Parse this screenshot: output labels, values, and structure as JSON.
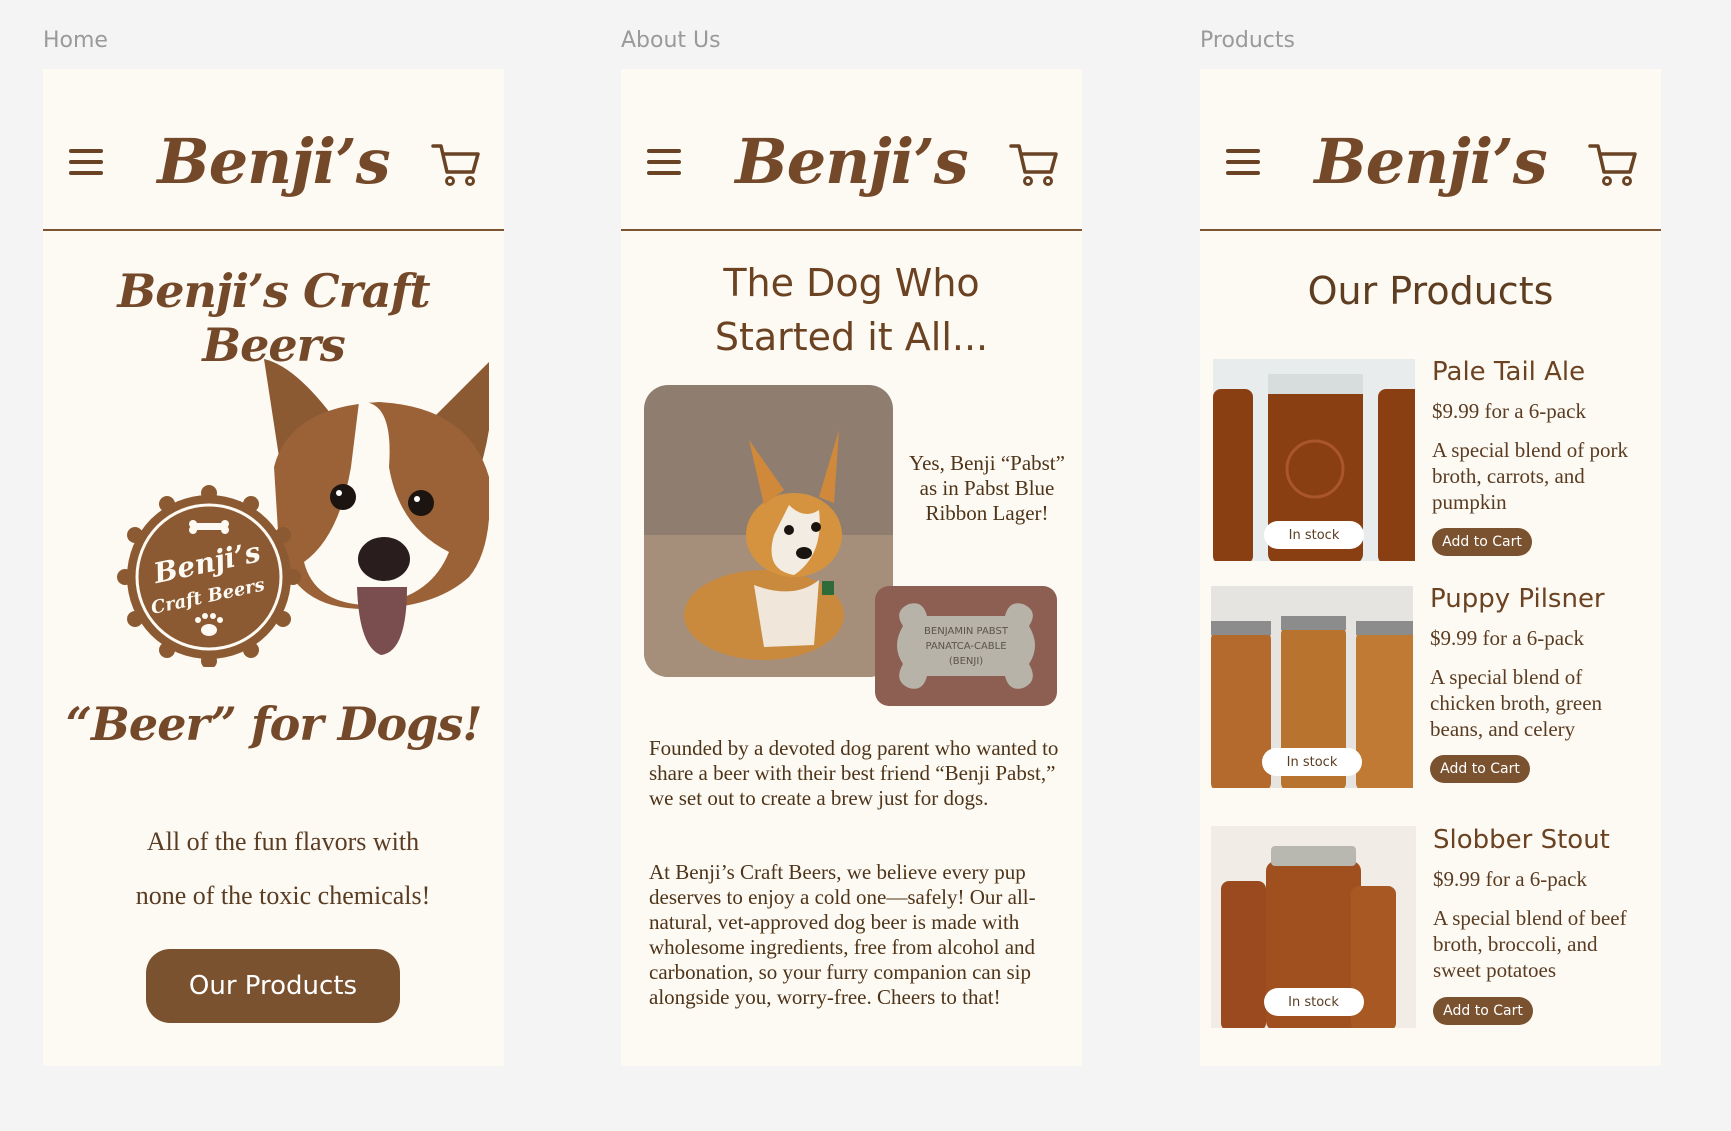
{
  "frames": {
    "home": {
      "label": "Home"
    },
    "about": {
      "label": "About Us"
    },
    "products": {
      "label": "Products"
    }
  },
  "brand": {
    "logo": "Benji’s"
  },
  "home": {
    "title": "Benji’s Craft Beers",
    "badge_line1": "Benji’s",
    "badge_line2": "Craft Beers",
    "tagline": "“Beer” for Dogs!",
    "subtitle_line1": "All of the fun flavors with",
    "subtitle_line2": "none of the toxic chemicals!",
    "cta": "Our Products"
  },
  "about": {
    "heading_line1": "The Dog Who",
    "heading_line2": "Started it All...",
    "caption": "Yes, Benji “Pabst” as in Pabst Blue Ribbon Lager!",
    "tag_line1": "BENJAMIN PABST",
    "tag_line2": "PANATCA-CABLE",
    "tag_line3": "(BENJI)",
    "paragraph1": "Founded by a devoted dog parent who wanted to share a beer with their best friend “Benji Pabst,” we set out to create a brew just for dogs.",
    "paragraph2": "At Benji’s Craft Beers, we believe every pup deserves to enjoy a cold one—safely! Our all-natural, vet-approved dog beer is made with wholesome ingredients, free from alcohol and carbonation, so your furry companion can sip alongside you, worry-free. Cheers to that!"
  },
  "products": {
    "heading": "Our Products",
    "items": [
      {
        "name": "Pale Tail Ale",
        "price": "$9.99 for a 6-pack",
        "desc": "A special blend of pork broth, carrots, and pumpkin",
        "stock": "In stock",
        "button": "Add to Cart",
        "liquid": "#8a3f12"
      },
      {
        "name": "Puppy Pilsner",
        "price": "$9.99 for a 6-pack",
        "desc": "A special blend of chicken broth, green beans, and celery",
        "stock": "In stock",
        "button": "Add to Cart",
        "liquid": "#b46a2c"
      },
      {
        "name": "Slobber Stout",
        "price": "$9.99 for a 6-pack",
        "desc": "A special blend of beef broth, broccoli, and sweet potatoes",
        "stock": "In stock",
        "button": "Add to Cart",
        "liquid": "#9a4a1e"
      }
    ]
  },
  "icons": {
    "menu": "hamburger-menu-icon",
    "cart": "shopping-cart-icon"
  },
  "colors": {
    "brand_brown": "#7b5230",
    "page_bg": "#fdfaf4",
    "canvas_bg": "#f4f4f4"
  }
}
